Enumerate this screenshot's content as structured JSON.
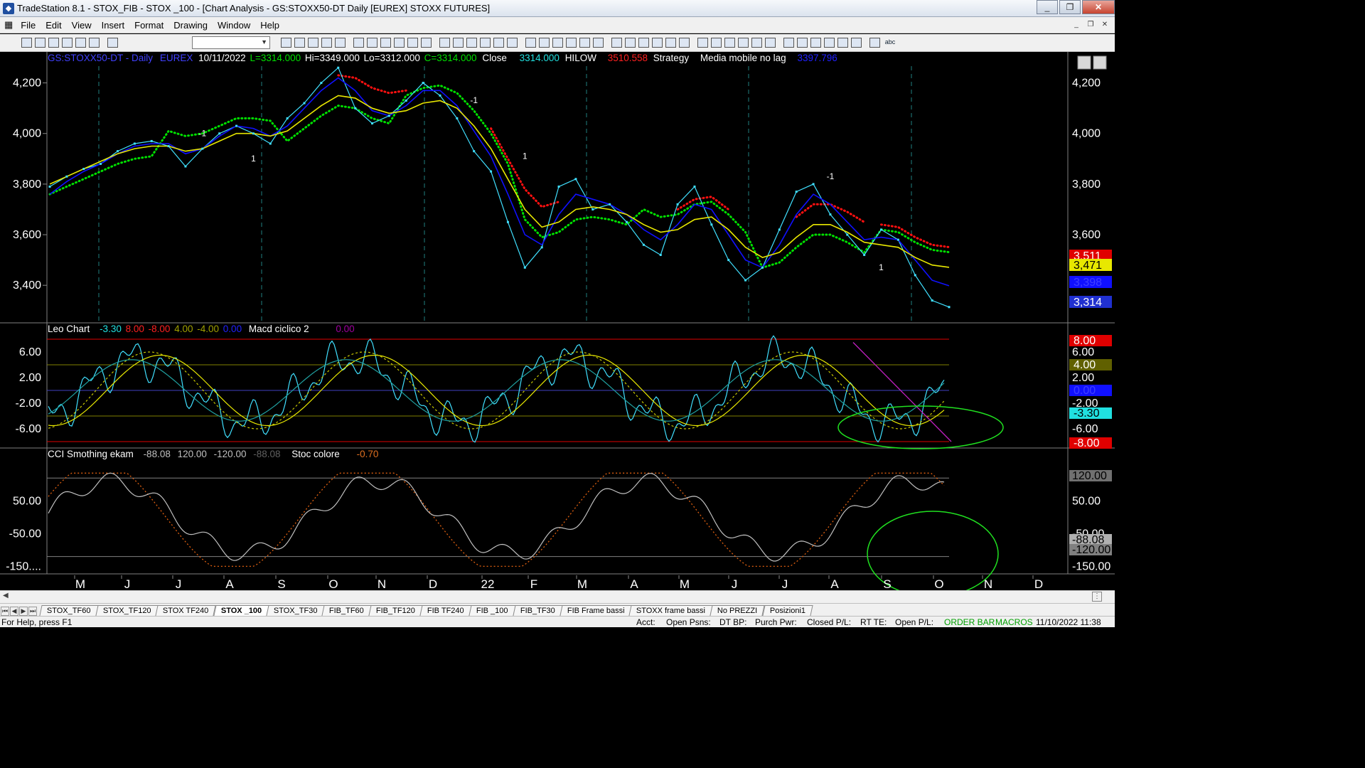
{
  "window": {
    "title": "TradeStation 8.1 - STOX_FIB - STOX _100 - [Chart Analysis - GS:STOXX50-DT  Daily  [EUREX] STOXX FUTURES]",
    "buttons": [
      "_",
      "❐",
      "✕"
    ]
  },
  "menu": [
    "File",
    "Edit",
    "View",
    "Insert",
    "Format",
    "Drawing",
    "Window",
    "Help"
  ],
  "toolbar": {
    "icons": [
      "new-icon",
      "open-icon",
      "save-icon",
      "print-icon",
      "chart-icon",
      "layout-icon",
      "grid-icon",
      "lock-icon",
      "folder-icon",
      "settings-icon",
      "globe-icon",
      "find-icon",
      "table-icon",
      "list-icon",
      "matrix-icon",
      "scanner-icon",
      "bars-icon",
      "order-icon",
      "hotlist-icon",
      "window-icon",
      "news-icon",
      "radar-icon",
      "candle-icon",
      "bar-icon",
      "line-icon",
      "point-icon",
      "zoom-in-icon",
      "zoom-out-icon",
      "cursor-icon",
      "crosshair-icon",
      "tools-icon",
      "export-icon",
      "help-icon",
      "pencil-icon",
      "lines-icon",
      "fib-icon",
      "channel-icon",
      "trend-icon",
      "angle-icon",
      "hline-icon",
      "vline-icon",
      "arrow-icon",
      "arc-icon",
      "pen-icon",
      "line-draw-icon",
      "arrow-down-icon",
      "arrow-up-icon",
      "ellipse-icon",
      "rectangle-icon",
      "text-icon"
    ],
    "text_tool_label": "abc"
  },
  "header": {
    "symbol": "GS:STOXX50-DT - Daily",
    "exchange": "EUREX",
    "date": "10/11/2022",
    "last": "L=3314.000",
    "high": "Hi=3349.000",
    "low": "Lo=3312.000",
    "close_eq": "C=3314.000",
    "close_label": "Close",
    "close_value": "3314.000",
    "hilow_label": "HILOW",
    "hilow_value": "3510.558",
    "strategy": "Strategy",
    "media_label": "Media mobile no lag",
    "media_value": "3397.796"
  },
  "panel2_header": {
    "name": "Leo Chart",
    "v1": "-3.30",
    "v2": "8.00",
    "v3": "-8.00",
    "v4": "4.00",
    "v5": "-4.00",
    "v6": "0.00",
    "name2": "Macd ciclico 2",
    "v7": "0.00"
  },
  "panel3_header": {
    "name": "CCI Smothing ekam",
    "v1": "-88.08",
    "v2": "120.00",
    "v3": "-120.00",
    "v4": "-88.08",
    "name2": "Stoc colore",
    "v5": "-0.70"
  },
  "axes": {
    "price_ticks": [
      "4,200",
      "4,000",
      "3,800",
      "3,600",
      "3,400"
    ],
    "osc_ticks": [
      "6.00",
      "2.00",
      "-2.00",
      "-6.00"
    ],
    "cci_ticks": [
      "50.00",
      "-50.00",
      "-150...."
    ],
    "right_price_ticks": [
      "4,200",
      "4,000",
      "3,800",
      "3,600"
    ],
    "right_osc_ticks": [
      "6.00",
      "2.00",
      "-2.00",
      "-6.00"
    ],
    "right_cci_ticks": [
      "50.00",
      "-50.00",
      "-150.00"
    ],
    "months": [
      "M",
      "J",
      "J",
      "A",
      "S",
      "O",
      "N",
      "D",
      "22",
      "F",
      "M",
      "A",
      "M",
      "J",
      "J",
      "A",
      "S",
      "O",
      "N",
      "D"
    ]
  },
  "right_labels": {
    "price": [
      {
        "text": "3,511",
        "bg": "#e00000",
        "fg": "#ffffff"
      },
      {
        "text": "3,471",
        "bg": "#e8e800",
        "fg": "#000000"
      },
      {
        "text": "3,398",
        "bg": "#1010ff",
        "fg": "#4040ff"
      },
      {
        "text": "3,314",
        "bg": "#2030d0",
        "fg": "#ffffff"
      }
    ],
    "osc": [
      {
        "text": "8.00",
        "bg": "#e00000",
        "fg": "#ffffff"
      },
      {
        "text": "4.00",
        "bg": "#606000",
        "fg": "#ffffff"
      },
      {
        "text": "0.00",
        "bg": "#1010ff",
        "fg": "#4040ff"
      },
      {
        "text": "-3.30",
        "bg": "#20e0e0",
        "fg": "#000000"
      },
      {
        "text": "-8.00",
        "bg": "#e00000",
        "fg": "#ffffff"
      }
    ],
    "cci": [
      {
        "text": "120.00",
        "bg": "#707070",
        "fg": "#000000"
      },
      {
        "text": "-88.08",
        "bg": "#b0b0b0",
        "fg": "#000000"
      },
      {
        "text": "-120.00",
        "bg": "#808080",
        "fg": "#000000"
      }
    ]
  },
  "chart_markers": [
    "-1",
    "1"
  ],
  "tabs": [
    "STOX_TF60",
    "STOX_TF120",
    "STOX TF240",
    "STOX _100",
    "STOX_TF30",
    "FIB_TF60",
    "FIB_TF120",
    "FIB TF240",
    "FIB _100",
    "FIB_TF30",
    "FIB Frame bassi",
    "STOXX frame bassi",
    "No PREZZI",
    "Posizioni1"
  ],
  "active_tab": "STOX _100",
  "status": {
    "help": "For Help, press F1",
    "acct": "Acct:",
    "open_psns": "Open Psns:",
    "dt_bp": "DT BP:",
    "purch_pwr": "Purch Pwr:",
    "closed_pl": "Closed P/L:",
    "rt_te": "RT TE:",
    "open_pl": "Open P/L:",
    "order_bar": "ORDER BAR",
    "macros": "MACROS",
    "datetime": "11/10/2022 11:38"
  },
  "chart_data": {
    "type": "line",
    "title": "GS:STOXX50-DT - Daily",
    "ylim": [
      3260,
      4300
    ],
    "x_months": [
      "M",
      "J",
      "J",
      "A",
      "S",
      "O",
      "N",
      "D",
      "22",
      "F",
      "M",
      "A",
      "M",
      "J",
      "J",
      "A",
      "S",
      "O"
    ],
    "series": [
      {
        "name": "Close",
        "color": "#40e0ff",
        "values": [
          3790,
          3830,
          3860,
          3880,
          3930,
          3960,
          3970,
          3950,
          3870,
          3940,
          4000,
          4030,
          4000,
          3960,
          4060,
          4120,
          4200,
          4260,
          4100,
          4040,
          4070,
          4130,
          4200,
          4150,
          4060,
          3930,
          3850,
          3650,
          3470,
          3550,
          3790,
          3820,
          3700,
          3720,
          3650,
          3560,
          3520,
          3720,
          3790,
          3640,
          3500,
          3420,
          3470,
          3620,
          3770,
          3800,
          3680,
          3600,
          3520,
          3620,
          3580,
          3440,
          3340,
          3314
        ]
      },
      {
        "name": "Media mobile no lag",
        "color": "#1010ff",
        "values": [
          3760,
          3810,
          3850,
          3880,
          3920,
          3950,
          3960,
          3960,
          3920,
          3940,
          3990,
          4030,
          4020,
          3990,
          4030,
          4100,
          4170,
          4220,
          4170,
          4090,
          4070,
          4110,
          4170,
          4170,
          4110,
          4010,
          3910,
          3760,
          3600,
          3560,
          3680,
          3760,
          3740,
          3720,
          3680,
          3620,
          3580,
          3640,
          3720,
          3700,
          3600,
          3500,
          3470,
          3560,
          3680,
          3760,
          3720,
          3650,
          3580,
          3590,
          3580,
          3500,
          3420,
          3398
        ]
      },
      {
        "name": "Strategy",
        "color": "#e8e800",
        "values": [
          3800,
          3830,
          3860,
          3890,
          3920,
          3940,
          3950,
          3950,
          3930,
          3940,
          3970,
          4000,
          4000,
          3990,
          4010,
          4060,
          4110,
          4150,
          4140,
          4100,
          4080,
          4090,
          4120,
          4130,
          4100,
          4030,
          3940,
          3820,
          3700,
          3630,
          3650,
          3700,
          3710,
          3700,
          3680,
          3640,
          3610,
          3620,
          3660,
          3670,
          3620,
          3550,
          3510,
          3530,
          3590,
          3640,
          3640,
          3610,
          3570,
          3560,
          3550,
          3510,
          3480,
          3471
        ]
      }
    ]
  }
}
